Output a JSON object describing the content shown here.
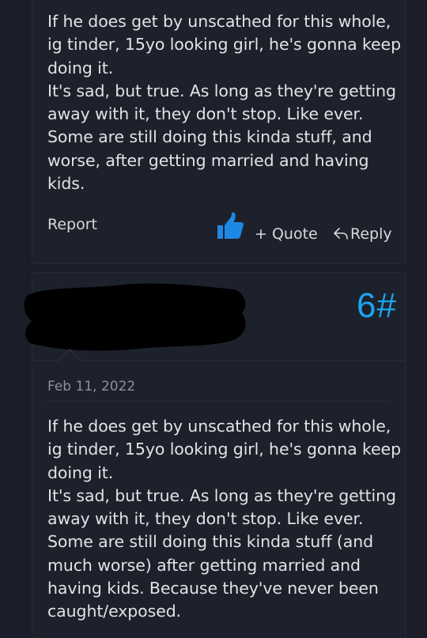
{
  "post_top": {
    "paragraphs": [
      "If he does get by unscathed for this whole, ig tinder, 15yo looking girl, he's gonna keep doing it.",
      "It's sad, but true. As long as they're getting away with it, they don't stop. Like ever. Some are still doing this kinda stuff, and worse, after getting married and having kids."
    ],
    "actions": {
      "report_label": "Report",
      "quote_label": "+ Quote",
      "reply_label": "Reply"
    }
  },
  "post_bottom": {
    "post_number": "6#",
    "date": "Feb 11, 2022",
    "paragraphs": [
      "If he does get by unscathed for this whole, ig tinder, 15yo looking girl, he's gonna keep doing it.",
      "It's sad, but true. As long as they're getting away with it, they don't stop. Like ever. Some are still doing this kinda stuff (and much worse) after getting married and having kids. Because they've never been caught/exposed."
    ]
  },
  "colors": {
    "background": "#1b1e28",
    "card": "#1d212b",
    "accent": "#1aa6f0",
    "like_icon": "#1e88e5"
  },
  "icons": {
    "like": "thumbs-up-icon",
    "reply": "reply-arrow-icon"
  }
}
